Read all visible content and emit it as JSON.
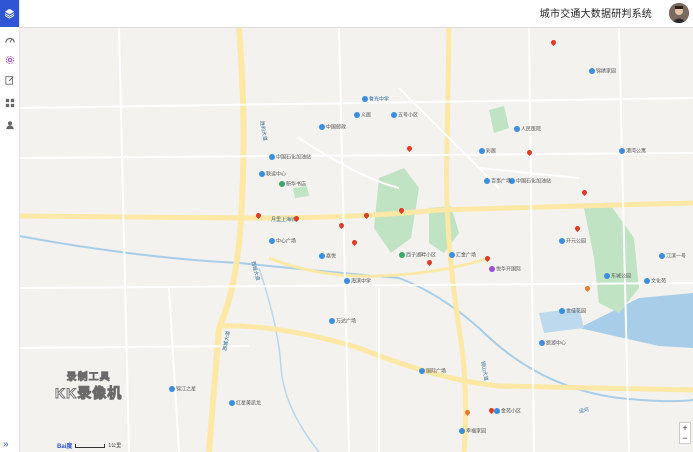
{
  "header": {
    "title": "城市交通大数据研判系统"
  },
  "sidebar": {
    "icons": [
      "layers-icon",
      "dashboard-icon",
      "settings-icon",
      "edit-icon",
      "grid-icon",
      "user-icon"
    ],
    "expand": "»"
  },
  "watermark": {
    "line1": "录制工具",
    "line2": "KK录像机"
  },
  "scale": {
    "label": "1公里"
  },
  "map_labels": {
    "road_xicheng": "西城大道",
    "road_shengli": "胜利大道",
    "road_tongshan": "铜山大道",
    "xicheng_ave": "西城大道",
    "yuexin": "月里上海城",
    "zhongguo_shihua": "中国石化加油站",
    "lianyun": "联运中心",
    "qingdao_yuzhong": "鲁光中学",
    "yiju": "义居",
    "wuhao_xiaoqu": "五号小区",
    "zhongguo_youdian": "中国邮政",
    "haibin": "海滨中学",
    "chengdong": "嘉悦",
    "xiguang": "西子湖畔小区",
    "huijin": "汇金广场",
    "hotel": "悦华开国际",
    "zhongguo_shiyou": "中国石化加油站",
    "caiju": "彩居",
    "wenhua_park": "文化苑",
    "dongfang": "东城公园",
    "jiangbin": "江滨一号",
    "baishi": "百事广场",
    "renmin": "人民医院",
    "kaiyuan": "开元公园",
    "shijia": "世佳花园",
    "lvyou": "旅游中心",
    "guoji": "国际广场",
    "jinjiang": "锦江之星",
    "hongxing": "红星美凯龙",
    "xinhua": "新华书店",
    "zhongxin": "中心广场",
    "wanda": "万达广场",
    "xingfu": "幸福家园",
    "jinyuan": "金苑小区",
    "gangwan": "港湾公寓",
    "jinxiu": "锦绣家园",
    "yunhe": "运河"
  },
  "zoom": {
    "plus": "+",
    "minus": "−"
  },
  "colors": {
    "accent": "#2f55d4",
    "road_main": "#fde8a6",
    "river": "#a8cde8",
    "green": "#bfe3c3"
  }
}
